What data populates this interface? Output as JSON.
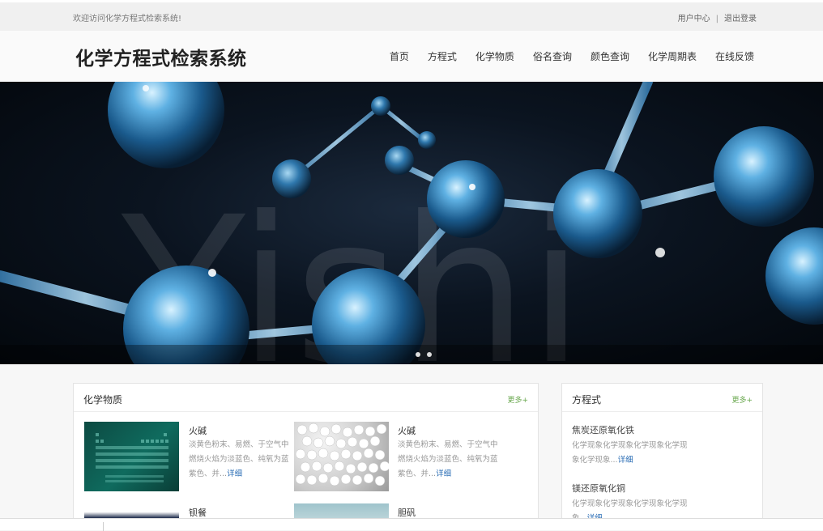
{
  "topbar": {
    "welcome": "欢迎访问化学方程式检索系统!",
    "user_center": "用户中心",
    "separator": "|",
    "logout": "退出登录"
  },
  "header": {
    "title": "化学方程式检索系统",
    "nav": [
      "首页",
      "方程式",
      "化学物质",
      "俗名查询",
      "颜色查询",
      "化学周期表",
      "在线反馈"
    ]
  },
  "hero": {
    "watermark": "Yishi",
    "slide_count": 2,
    "active_slide": 1
  },
  "substances": {
    "title": "化学物质",
    "more": "更多+",
    "items": [
      {
        "name": "火碱",
        "desc": "淡黄色粉末、易燃、于空气中燃烧火焰为淡蓝色、纯氧为蓝紫色、并...",
        "detail": "详细"
      },
      {
        "name": "火碱",
        "desc": "淡黄色粉末、易燃、于空气中燃烧火焰为淡蓝色、纯氧为蓝紫色、并...",
        "detail": "详细"
      },
      {
        "name": "钡餐",
        "desc": "",
        "detail": ""
      },
      {
        "name": "胆矾",
        "desc": "",
        "detail": ""
      }
    ]
  },
  "equations": {
    "title": "方程式",
    "more": "更多+",
    "items": [
      {
        "name": "焦炭还原氧化铁",
        "desc": "化学现象化学现象化学现象化学现象化学现象...",
        "detail": "详细"
      },
      {
        "name": "镁还原氧化铜",
        "desc": "化学现象化学现象化学现象化学现象...",
        "detail": "详细"
      }
    ]
  },
  "colors": {
    "accent": "#6aa84f",
    "link": "#2a6db5",
    "hero_bg": "#0b1420"
  }
}
